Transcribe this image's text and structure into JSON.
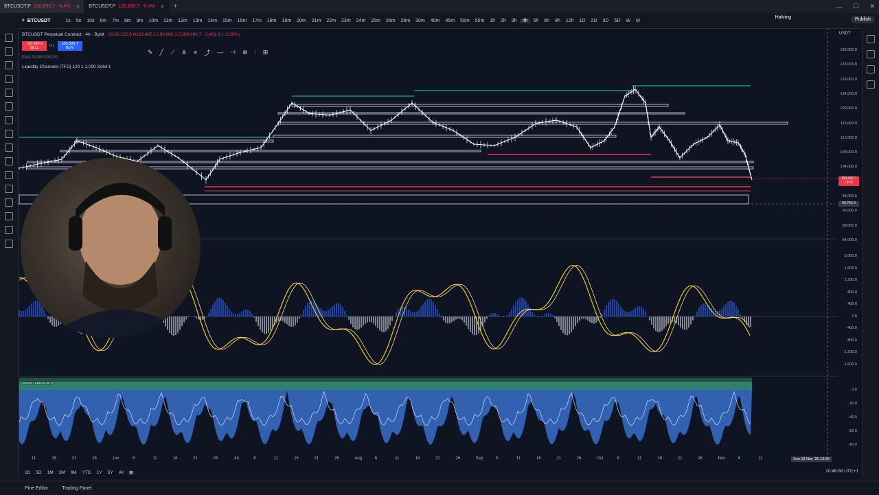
{
  "tabs": [
    {
      "symbol": "BTCUSDT.P",
      "price": "100,690.7",
      "change": "-5.4%",
      "active": false
    },
    {
      "symbol": "BTCUSDT.P",
      "price": "100,690.7",
      "change": "-5.4%",
      "active": true
    }
  ],
  "toolbar": {
    "symbol": "BTCUSDT",
    "intervals": [
      "1s",
      "5s",
      "10s",
      "15s",
      "30s",
      "1m",
      "2m",
      "3m",
      "4m",
      "5m",
      "6m",
      "7m",
      "8m",
      "9m",
      "10m",
      "11m",
      "12m",
      "13m",
      "14m",
      "15m",
      "16m",
      "17m",
      "18m",
      "19m",
      "20m",
      "21m",
      "22m",
      "23m",
      "24m",
      "25m",
      "26m",
      "28m",
      "30m",
      "40m",
      "45m",
      "50m",
      "55m",
      "1h",
      "2h",
      "3h",
      "4h",
      "5h",
      "6h",
      "8h",
      "12h",
      "1D",
      "2D",
      "3D",
      "5D",
      "W",
      "M"
    ],
    "active_interval": "4h",
    "halving_label": "Halving",
    "publish_label": "Publish"
  },
  "legend": {
    "title": "BTCUSDT Perpetual Contract · 4h · Bybit",
    "ohlc": "O103,152.6 H103,465.1 L99,900.1 C100,690.7 −2,461.9 (−2.39%)",
    "sell_price": "100,690.6",
    "sell_label": "SELL",
    "spread": "0.1",
    "buy_price": "100,690.7",
    "buy_label": "BUY",
    "indicator_ema": "EMA 20/50/100/200",
    "indicator_liq": "Liquidity Channels [TFO] 120 1 1,000 Solid 1",
    "oscillator_label": "MARKET LIBERATOR ®"
  },
  "price_axis": {
    "currency": "USDT",
    "ticks": [
      "136,000.0",
      "132,000.0",
      "128,000.0",
      "124,000.0",
      "120,000.0",
      "116,000.0",
      "112,000.0",
      "108,000.0",
      "104,000.0",
      "100,000.0",
      "96,000.0",
      "92,000.0",
      "88,000.0",
      "84,000.0"
    ],
    "current_price": "100,690.7",
    "current_time": "13:51",
    "crosshair_price": "93,753.9",
    "osc1_ticks": [
      "2,000.0",
      "1,600.0",
      "1,200.0",
      "800.0",
      "400.0",
      "0.0",
      "-400.0",
      "-800.0",
      "-1,200.0",
      "-1,600.0"
    ],
    "osc2_ticks": [
      "0.0",
      "-20.0",
      "-40.0",
      "-60.0",
      "-80.0"
    ]
  },
  "time_axis": {
    "labels": [
      "11",
      "16",
      "21",
      "26",
      "Jun",
      "6",
      "11",
      "16",
      "21",
      "26",
      "Jul",
      "6",
      "11",
      "16",
      "21",
      "26",
      "Aug",
      "6",
      "11",
      "16",
      "21",
      "26",
      "Sep",
      "6",
      "11",
      "16",
      "21",
      "26",
      "Oct",
      "6",
      "11",
      "16",
      "21",
      "26",
      "Nov",
      "6",
      "11"
    ],
    "crosshair_time": "Sun 23 Nov '25  13:00"
  },
  "bottom": {
    "ranges": [
      "1D",
      "5D",
      "1M",
      "3M",
      "6M",
      "YTD",
      "1Y",
      "5Y",
      "All"
    ],
    "clock": "20:46:08 UTC+1",
    "pine_editor": "Pine Editor",
    "trading_panel": "Trading Panel"
  },
  "colors": {
    "bg": "#0f1422",
    "candle": "#ffffff",
    "red": "#f23645",
    "green": "#22ab94",
    "blue": "#2962ff",
    "yellow": "#f5c518"
  }
}
